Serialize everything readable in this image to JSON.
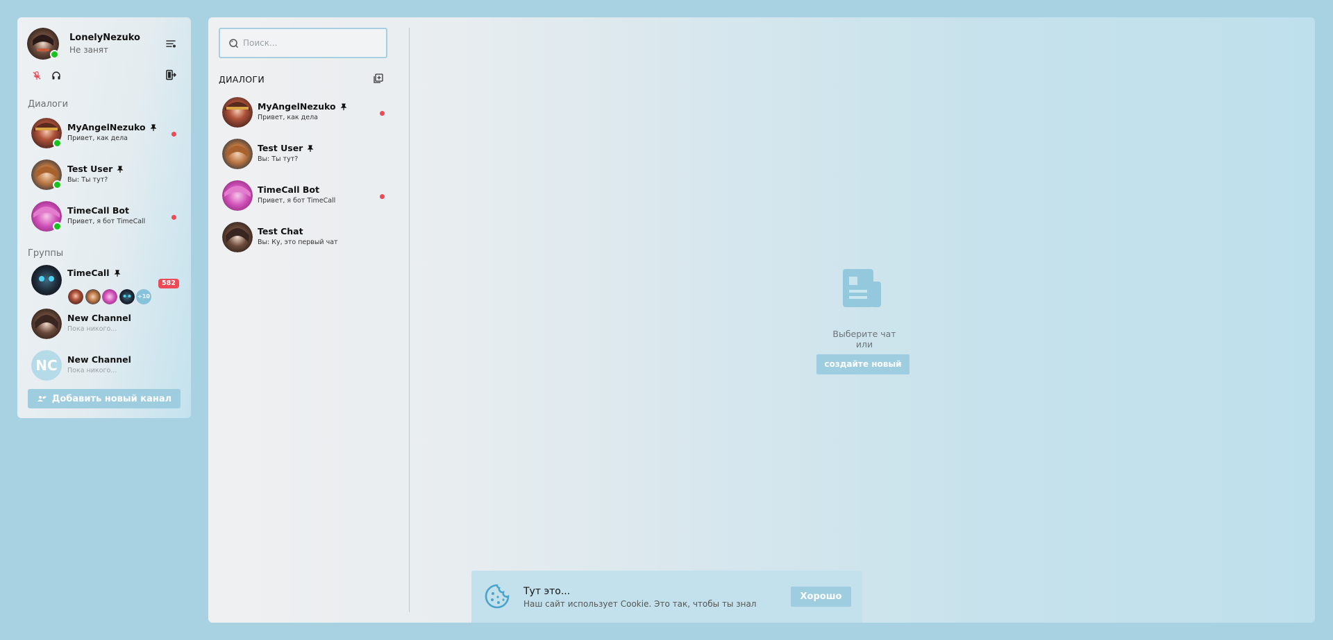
{
  "user": {
    "name": "LonelyNezuko",
    "status": "Не занят"
  },
  "sidebar": {
    "dialogs_label": "Диалоги",
    "groups_label": "Группы",
    "dialogs": [
      {
        "name": "MyAngelNezuko",
        "last_message": "Привет, как дела",
        "pinned": true,
        "online": true,
        "unread": true,
        "avatar_color": "#8a3b2e"
      },
      {
        "name": "Test User",
        "last_message": "Вы: Ты тут?",
        "pinned": true,
        "online": true,
        "unread": false,
        "avatar_color": "#b46a3a"
      },
      {
        "name": "TimeCall Bot",
        "last_message": "Привет, я бот TimeCall",
        "pinned": false,
        "online": true,
        "unread": true,
        "avatar_color": "#d04fb8"
      }
    ],
    "groups": [
      {
        "name": "TimeCall",
        "pinned": true,
        "more_members": "+10",
        "unread_count": "582"
      },
      {
        "name": "New Channel",
        "last_message": "Пока никого..."
      },
      {
        "name": "New Channel",
        "initials": "NC",
        "last_message": "Пока никого..."
      }
    ],
    "add_channel_label": "Добавить новый канал"
  },
  "main": {
    "search_placeholder": "Поиск...",
    "dialogs_header": "ДИАЛОГИ",
    "dialogs": [
      {
        "name": "MyAngelNezuko",
        "last_message": "Привет, как дела",
        "pinned": true,
        "unread": true
      },
      {
        "name": "Test User",
        "last_message": "Вы: Ты тут?",
        "pinned": true,
        "unread": false
      },
      {
        "name": "TimeCall Bot",
        "last_message": "Привет, я бот TimeCall",
        "pinned": false,
        "unread": true
      },
      {
        "name": "Test Chat",
        "last_message": "Вы: Ку, это первый чат",
        "pinned": false,
        "unread": false
      }
    ],
    "empty_state": {
      "line1": "Выберите чат",
      "line2": "или",
      "create_label": "создайте новый"
    }
  },
  "cookie_banner": {
    "title": "Тут это...",
    "text": "Наш сайт использует Cookie. Это так, чтобы ты знал",
    "ok_label": "Хорошо"
  },
  "colors": {
    "page_bg": "#a8d2e2",
    "accent": "#9ecde0",
    "online": "#19c21d",
    "unread": "#ee4a56"
  },
  "icons": [
    "settings-icon",
    "mic-off-icon",
    "headphones-icon",
    "logout-icon",
    "pin-icon",
    "search-icon",
    "new-dialog-icon",
    "chat-placeholder-icon",
    "cookie-icon",
    "add-users-icon"
  ]
}
